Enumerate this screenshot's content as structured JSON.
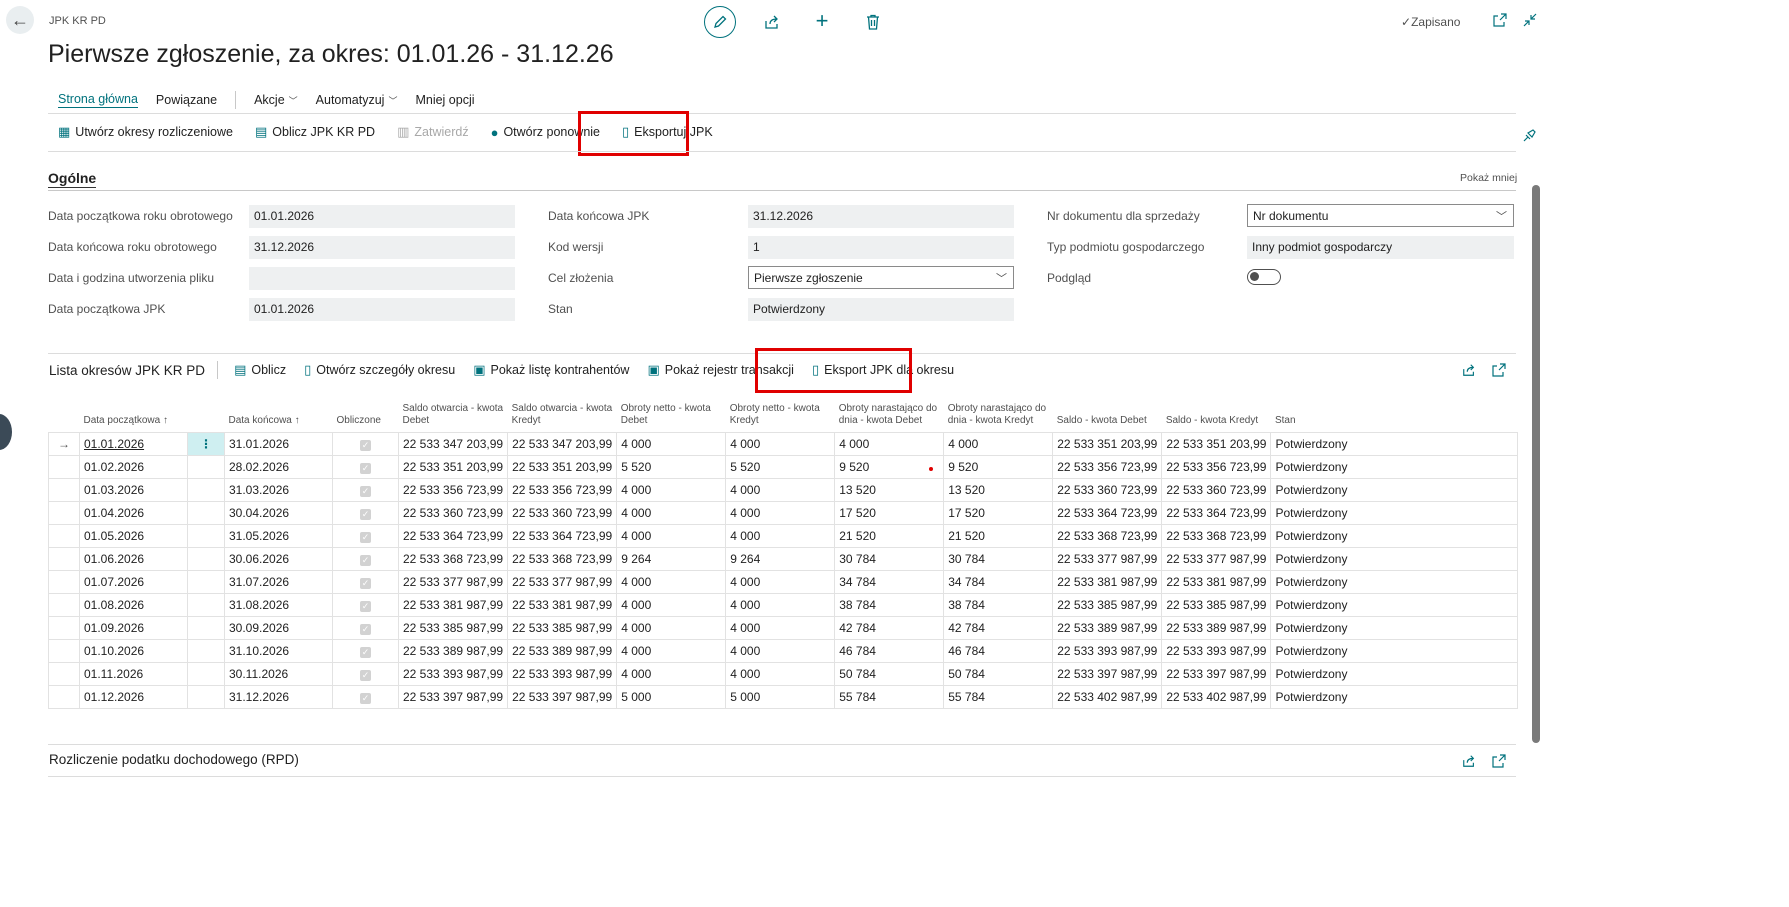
{
  "header": {
    "breadcrumb": "JPK KR PD",
    "title": "Pierwsze zgłoszenie, za okres: 01.01.26 - 31.12.26",
    "saved_status": "Zapisano"
  },
  "tabs": {
    "home": "Strona główna",
    "related": "Powiązane",
    "actions": "Akcje",
    "automate": "Automatyzuj",
    "less": "Mniej opcji"
  },
  "actions": {
    "create_periods": "Utwórz okresy rozliczeniowe",
    "calculate": "Oblicz JPK KR PD",
    "approve": "Zatwierdź",
    "reopen": "Otwórz ponownie",
    "export": "Eksportuj JPK"
  },
  "general": {
    "section_title": "Ogólne",
    "show_less": "Pokaż mniej",
    "fy_start_label": "Data początkowa roku obrotowego",
    "fy_start_value": "01.01.2026",
    "fy_end_label": "Data końcowa roku obrotowego",
    "fy_end_value": "31.12.2026",
    "file_created_label": "Data i godzina utworzenia pliku",
    "file_created_value": "",
    "jpk_start_label": "Data początkowa JPK",
    "jpk_start_value": "01.01.2026",
    "jpk_end_label": "Data końcowa JPK",
    "jpk_end_value": "31.12.2026",
    "version_label": "Kod wersji",
    "version_value": "1",
    "purpose_label": "Cel złożenia",
    "purpose_value": "Pierwsze zgłoszenie",
    "status_label": "Stan",
    "status_value": "Potwierdzony",
    "sales_doc_label": "Nr dokumentu dla sprzedaży",
    "sales_doc_value": "Nr dokumentu",
    "entity_type_label": "Typ podmiotu gospodarczego",
    "entity_type_value": "Inny podmiot gospodarczy",
    "preview_label": "Podgląd",
    "preview_on": false
  },
  "periods": {
    "title": "Lista okresów JPK KR PD",
    "calc": "Oblicz",
    "open_details": "Otwórz szczegóły okresu",
    "show_contractors": "Pokaż listę kontrahentów",
    "show_register": "Pokaż rejestr transakcji",
    "export_period": "Eksport JPK dla okresu",
    "columns": [
      "Data początkowa ↑",
      "Data końcowa ↑",
      "Obliczone",
      "Saldo otwarcia - kwota Debet",
      "Saldo otwarcia - kwota Kredyt",
      "Obroty netto - kwota Debet",
      "Obroty netto - kwota Kredyt",
      "Obroty narastająco do dnia - kwota Debet",
      "Obroty narastająco do dnia - kwota Kredyt",
      "Saldo - kwota Debet",
      "Saldo - kwota Kredyt",
      "Stan"
    ],
    "rows": [
      [
        "01.01.2026",
        "31.01.2026",
        "22 533 347 203,99",
        "22 533 347 203,99",
        "4 000",
        "4 000",
        "4 000",
        "4 000",
        "22 533 351 203,99",
        "22 533 351 203,99",
        "Potwierdzony"
      ],
      [
        "01.02.2026",
        "28.02.2026",
        "22 533 351 203,99",
        "22 533 351 203,99",
        "5 520",
        "5 520",
        "9 520",
        "9 520",
        "22 533 356 723,99",
        "22 533 356 723,99",
        "Potwierdzony"
      ],
      [
        "01.03.2026",
        "31.03.2026",
        "22 533 356 723,99",
        "22 533 356 723,99",
        "4 000",
        "4 000",
        "13 520",
        "13 520",
        "22 533 360 723,99",
        "22 533 360 723,99",
        "Potwierdzony"
      ],
      [
        "01.04.2026",
        "30.04.2026",
        "22 533 360 723,99",
        "22 533 360 723,99",
        "4 000",
        "4 000",
        "17 520",
        "17 520",
        "22 533 364 723,99",
        "22 533 364 723,99",
        "Potwierdzony"
      ],
      [
        "01.05.2026",
        "31.05.2026",
        "22 533 364 723,99",
        "22 533 364 723,99",
        "4 000",
        "4 000",
        "21 520",
        "21 520",
        "22 533 368 723,99",
        "22 533 368 723,99",
        "Potwierdzony"
      ],
      [
        "01.06.2026",
        "30.06.2026",
        "22 533 368 723,99",
        "22 533 368 723,99",
        "9 264",
        "9 264",
        "30 784",
        "30 784",
        "22 533 377 987,99",
        "22 533 377 987,99",
        "Potwierdzony"
      ],
      [
        "01.07.2026",
        "31.07.2026",
        "22 533 377 987,99",
        "22 533 377 987,99",
        "4 000",
        "4 000",
        "34 784",
        "34 784",
        "22 533 381 987,99",
        "22 533 381 987,99",
        "Potwierdzony"
      ],
      [
        "01.08.2026",
        "31.08.2026",
        "22 533 381 987,99",
        "22 533 381 987,99",
        "4 000",
        "4 000",
        "38 784",
        "38 784",
        "22 533 385 987,99",
        "22 533 385 987,99",
        "Potwierdzony"
      ],
      [
        "01.09.2026",
        "30.09.2026",
        "22 533 385 987,99",
        "22 533 385 987,99",
        "4 000",
        "4 000",
        "42 784",
        "42 784",
        "22 533 389 987,99",
        "22 533 389 987,99",
        "Potwierdzony"
      ],
      [
        "01.10.2026",
        "31.10.2026",
        "22 533 389 987,99",
        "22 533 389 987,99",
        "4 000",
        "4 000",
        "46 784",
        "46 784",
        "22 533 393 987,99",
        "22 533 393 987,99",
        "Potwierdzony"
      ],
      [
        "01.11.2026",
        "30.11.2026",
        "22 533 393 987,99",
        "22 533 393 987,99",
        "4 000",
        "4 000",
        "50 784",
        "50 784",
        "22 533 397 987,99",
        "22 533 397 987,99",
        "Potwierdzony"
      ],
      [
        "01.12.2026",
        "31.12.2026",
        "22 533 397 987,99",
        "22 533 397 987,99",
        "5 000",
        "5 000",
        "55 784",
        "55 784",
        "22 533 402 987,99",
        "22 533 402 987,99",
        "Potwierdzony"
      ]
    ]
  },
  "rpd": {
    "title": "Rozliczenie podatku dochodowego (RPD)"
  },
  "colors": {
    "accent": "#00727d",
    "highlight_border": "#e00000",
    "field_bg": "#eef0f1"
  }
}
